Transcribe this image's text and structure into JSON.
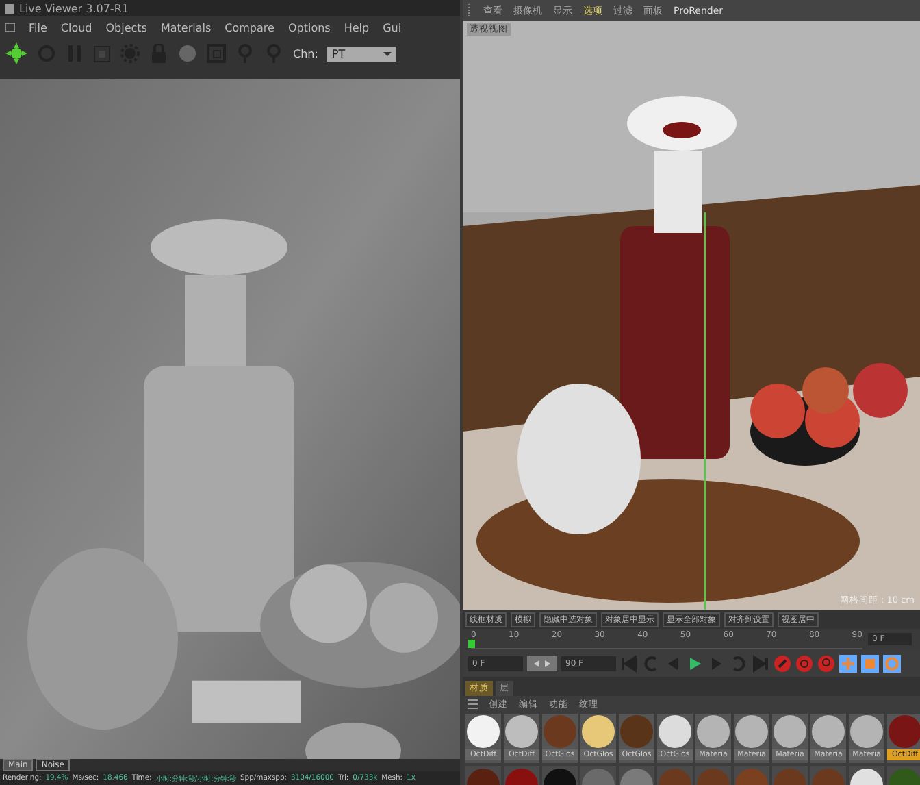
{
  "live_viewer": {
    "title": "Live Viewer 3.07-R1",
    "menu": [
      "File",
      "Cloud",
      "Objects",
      "Materials",
      "Compare",
      "Options",
      "Help",
      "Gui"
    ],
    "channel_label": "Chn:",
    "channel_value": "PT",
    "tabs": [
      {
        "label": "Main",
        "selected": true
      },
      {
        "label": "Noise",
        "selected": false
      }
    ],
    "status": [
      {
        "label": "Rendering:",
        "value": "19.4%"
      },
      {
        "label": "Ms/sec:",
        "value": "18.466"
      },
      {
        "label": "Time:",
        "value": "小时:分钟:秒/小时:分钟:秒"
      },
      {
        "label": "Spp/maxspp:",
        "value": "3104/16000"
      },
      {
        "label": "Tri:",
        "value": "0/733k"
      },
      {
        "label": "Mesh:",
        "value": "1x"
      }
    ]
  },
  "viewport": {
    "menu": [
      {
        "label": "查看",
        "selected": false
      },
      {
        "label": "摄像机",
        "selected": false
      },
      {
        "label": "显示",
        "selected": false
      },
      {
        "label": "选项",
        "selected": true
      },
      {
        "label": "过滤",
        "selected": false
      },
      {
        "label": "面板",
        "selected": false
      },
      {
        "label": "ProRender",
        "selected": false
      }
    ],
    "view_label": "透视视图",
    "grid_label": "网格间距 : 10 cm"
  },
  "timeline": {
    "toolbar": [
      "线框材质",
      "模拟",
      "隐藏中选对象",
      "对象居中显示",
      "显示全部对象",
      "对齐到设置",
      "视图居中"
    ],
    "ticks": [
      "0",
      "10",
      "20",
      "30",
      "40",
      "50",
      "60",
      "70",
      "80",
      "90"
    ],
    "level": 0.0,
    "frame_field": "0 F",
    "start_field": "0 F",
    "end_field": "90 F"
  },
  "materials": {
    "tabs": [
      {
        "label": "材质",
        "selected": true
      },
      {
        "label": "层",
        "selected": false
      }
    ],
    "menu": [
      "创建",
      "编辑",
      "功能",
      "纹理"
    ],
    "items": [
      {
        "name": "OctDiff",
        "color": "#f2f2f2",
        "selected": false
      },
      {
        "name": "OctDiff",
        "color": "#bdbdbd",
        "selected": false
      },
      {
        "name": "OctGlos",
        "color": "#6b3a1e",
        "selected": false
      },
      {
        "name": "OctGlos",
        "color": "#e6c878",
        "selected": false
      },
      {
        "name": "OctGlos",
        "color": "#5a3418",
        "selected": false
      },
      {
        "name": "OctGlos",
        "color": "#dcdcdc",
        "selected": false
      },
      {
        "name": "Materia",
        "color": "#b4b4b4",
        "selected": false
      },
      {
        "name": "Materia",
        "color": "#b4b4b4",
        "selected": false
      },
      {
        "name": "Materia",
        "color": "#b4b4b4",
        "selected": false
      },
      {
        "name": "Materia",
        "color": "#b4b4b4",
        "selected": false
      },
      {
        "name": "Materia",
        "color": "#b4b4b4",
        "selected": false
      },
      {
        "name": "OctDiff",
        "color": "#7a1515",
        "selected": true
      }
    ],
    "more_items": [
      {
        "color": "#5a2010"
      },
      {
        "color": "#8a1010"
      },
      {
        "color": "#111111"
      },
      {
        "color": "#6a6a6a"
      },
      {
        "color": "#7a7a7a"
      },
      {
        "color": "#6b3a1e"
      },
      {
        "color": "#6b3a1e"
      },
      {
        "color": "#7a4020"
      },
      {
        "color": "#6b3a1e"
      },
      {
        "color": "#6b3a1e"
      },
      {
        "color": "#e0e0e0"
      },
      {
        "color": "#2f5a1a"
      }
    ]
  }
}
